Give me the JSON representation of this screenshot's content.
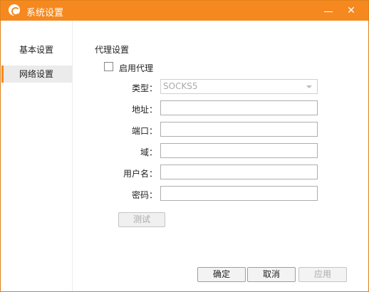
{
  "window": {
    "title": "系统设置"
  },
  "sidebar": {
    "items": [
      {
        "label": "基本设置"
      },
      {
        "label": "网络设置",
        "selected": true
      }
    ]
  },
  "proxy": {
    "section_title": "代理设置",
    "enable_label": "启用代理",
    "enabled": false,
    "type": {
      "label": "类型：",
      "value": "SOCKS5"
    },
    "address": {
      "label": "地址：",
      "value": ""
    },
    "port": {
      "label": "端口：",
      "value": ""
    },
    "domain": {
      "label": "域：",
      "value": ""
    },
    "username": {
      "label": "用户名：",
      "value": ""
    },
    "password": {
      "label": "密码：",
      "value": ""
    },
    "test_label": "测试"
  },
  "footer": {
    "ok_label": "确定",
    "cancel_label": "取消",
    "apply_label": "应用"
  },
  "icons": {
    "minimize": "minimize-icon",
    "close": "close-icon",
    "logo": "app-logo-icon",
    "dropdown": "chevron-down-icon"
  },
  "colors": {
    "accent": "#f5891f",
    "selected_nav_bg": "#ebebeb"
  }
}
